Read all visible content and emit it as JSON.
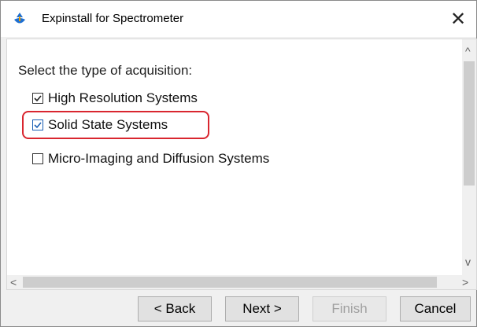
{
  "window": {
    "title": "Expinstall for Spectrometer",
    "close_glyph": "✕"
  },
  "content": {
    "prompt": "Select the type of acquisition:",
    "options": [
      {
        "label": "High Resolution Systems",
        "checked": true
      },
      {
        "label": "Solid State Systems",
        "checked": true,
        "highlighted": true,
        "highlight_color": "#d9262f"
      },
      {
        "label": "Micro-Imaging and Diffusion Systems",
        "checked": false
      }
    ]
  },
  "scrollbars": {
    "up_arrow": "^",
    "down_arrow": "v",
    "left_arrow": "<",
    "right_arrow": ">"
  },
  "buttons": {
    "back": "< Back",
    "next": "Next >",
    "finish": "Finish",
    "cancel": "Cancel"
  },
  "icons": {
    "app": "spectrometer-app-icon",
    "close": "close-icon",
    "check": "checkmark-icon"
  }
}
